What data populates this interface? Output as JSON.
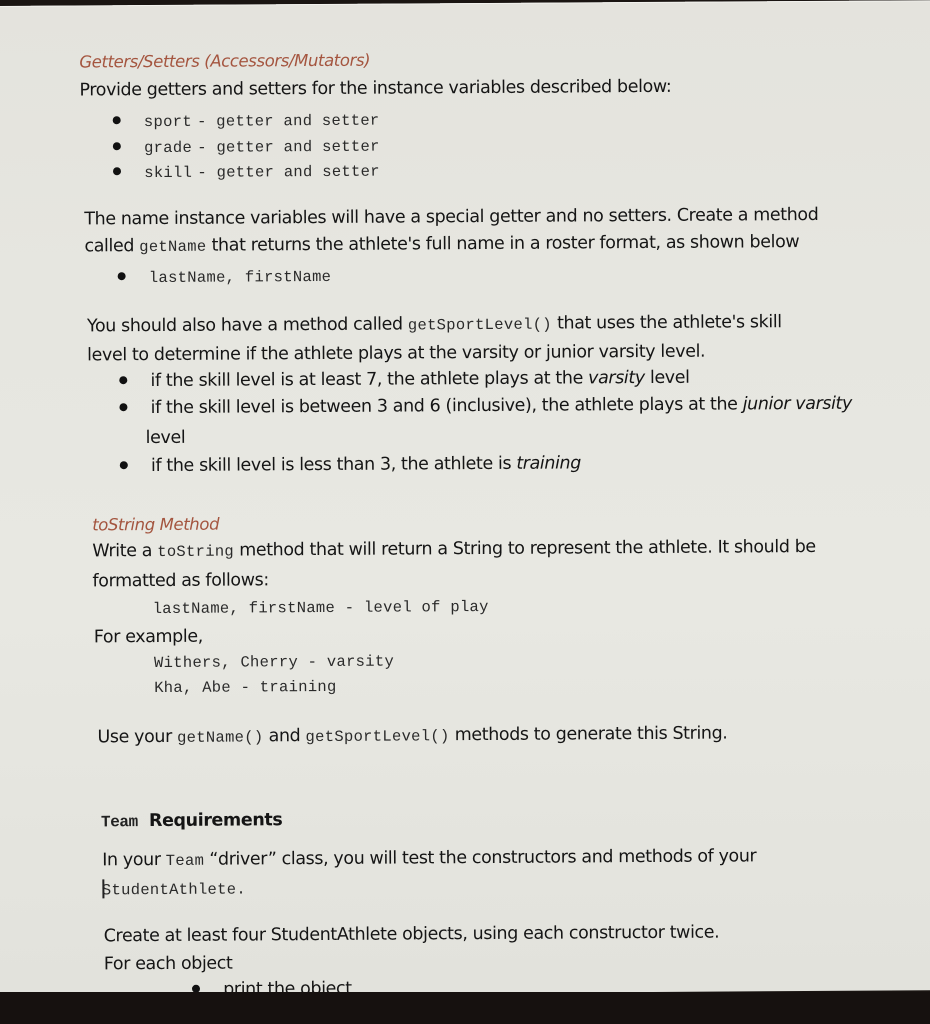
{
  "getters_setters": {
    "title": "Getters/Setters (Accessors/Mutators)",
    "intro": "Provide getters and setters for the instance variables described below:",
    "items": [
      {
        "var": "sport",
        "desc": "- getter and setter"
      },
      {
        "var": "grade",
        "desc": "- getter and setter"
      },
      {
        "var": "skill",
        "desc": "- getter and setter"
      }
    ]
  },
  "name_getter": {
    "line1": "The name instance variables will have a special getter and no setters.  Create a method",
    "line2_pre": "called ",
    "line2_code": "getName",
    "line2_post": " that returns the athlete's full name in a roster format, as shown below",
    "bullet": "lastName, firstName"
  },
  "sport_level": {
    "line1_pre": "You should also have a method called ",
    "line1_code": "getSportLevel()",
    "line1_post": " that uses the athlete's skill",
    "line2": "level to determine if the athlete plays at the varsity or junior varsity level.",
    "rules": [
      {
        "pre": "if the skill level is at least 7, the athlete plays at the ",
        "em": "varsity",
        "post": " level"
      },
      {
        "pre": "if the skill level is between 3 and 6 (inclusive), the athlete plays at the ",
        "em": "junior varsity",
        "post": "",
        "continuation": "level"
      },
      {
        "pre": "if the skill level is less than 3, the athlete is ",
        "em": "training",
        "post": ""
      }
    ]
  },
  "tostring": {
    "title": "toString Method",
    "line1_pre": "Write a ",
    "line1_code": "toString",
    "line1_post": " method that will return a String to represent the athlete.  It should be",
    "line2": "formatted as follows:",
    "format": "lastName, firstName - level of play",
    "example_label": "For example,",
    "examples": [
      "Withers, Cherry - varsity",
      "Kha, Abe - training"
    ],
    "use_pre": "Use your ",
    "use_code1": "getName()",
    "use_mid": " and ",
    "use_code2": "getSportLevel()",
    "use_post": "  methods to generate this String."
  },
  "team": {
    "title_code": "Team",
    "title_text": "Requirements",
    "line1_pre": "In your ",
    "line1_code": "Team",
    "line1_post": "  “driver” class, you will test the constructors and methods of your",
    "line2_code": "StudentAthlete.",
    "create": "Create at least four StudentAthlete objects, using each constructor twice.",
    "for_each": "For each object",
    "tasks": [
      "print the object"
    ]
  }
}
